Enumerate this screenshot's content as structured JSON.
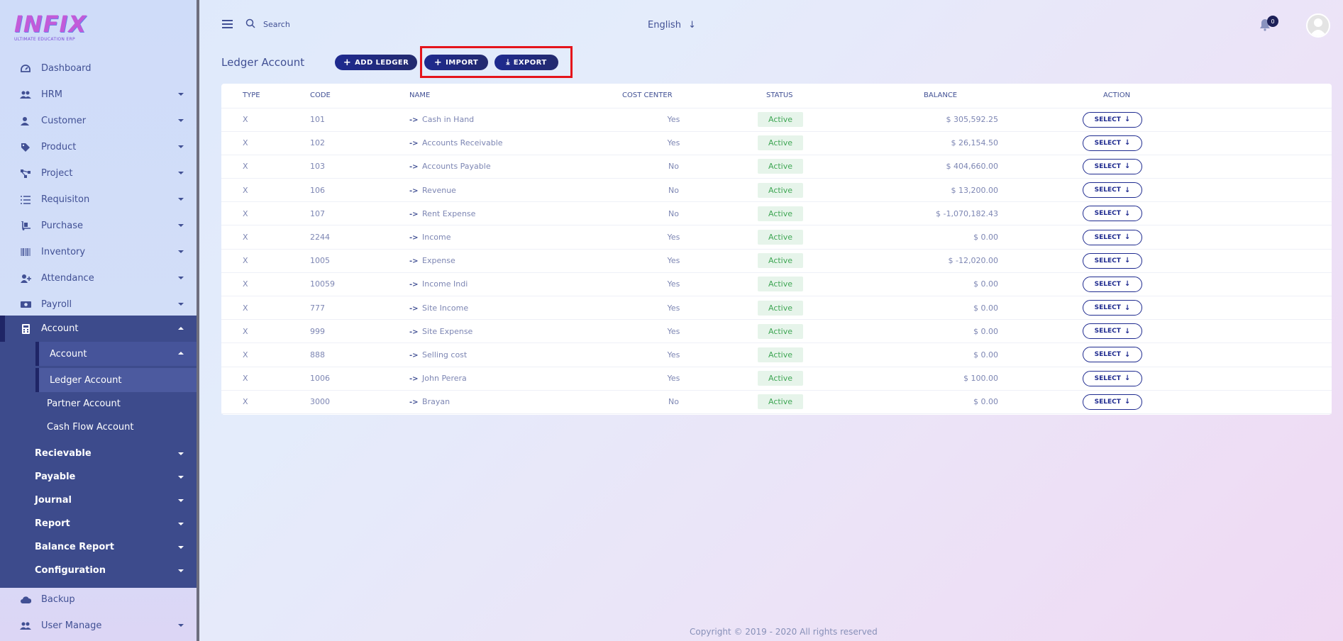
{
  "brand": {
    "logo_text": "INFIX",
    "tagline": "ULTIMATE EDUCATION ERP"
  },
  "sidebar": {
    "items": [
      {
        "label": "Dashboard",
        "icon": "dashboard-icon",
        "caret": false
      },
      {
        "label": "HRM",
        "icon": "users-icon",
        "caret": true
      },
      {
        "label": "Customer",
        "icon": "user-icon",
        "caret": true
      },
      {
        "label": "Product",
        "icon": "tags-icon",
        "caret": true
      },
      {
        "label": "Project",
        "icon": "project-icon",
        "caret": true
      },
      {
        "label": "Requisiton",
        "icon": "list-icon",
        "caret": true
      },
      {
        "label": "Purchase",
        "icon": "dolly-icon",
        "caret": true
      },
      {
        "label": "Inventory",
        "icon": "barcode-icon",
        "caret": true
      },
      {
        "label": "Attendance",
        "icon": "user-plus-icon",
        "caret": true
      },
      {
        "label": "Payroll",
        "icon": "money-icon",
        "caret": true
      }
    ],
    "account": {
      "label": "Account",
      "sub_label": "Account",
      "children": [
        "Ledger Account",
        "Partner Account",
        "Cash Flow Account"
      ],
      "groups": [
        "Recievable",
        "Payable",
        "Journal",
        "Report",
        "Balance Report",
        "Configuration"
      ]
    },
    "bottom_items": [
      {
        "label": "Backup",
        "icon": "cloud-icon",
        "caret": false
      },
      {
        "label": "User Manage",
        "icon": "users-icon",
        "caret": true
      }
    ]
  },
  "header": {
    "search_placeholder": "Search",
    "language": "English",
    "notification_count": "0"
  },
  "page": {
    "title": "Ledger Account",
    "buttons": {
      "add": "ADD LEDGER",
      "import": "IMPORT",
      "export": "EXPORT"
    }
  },
  "table": {
    "columns": [
      "TYPE",
      "CODE",
      "NAME",
      "COST CENTER",
      "STATUS",
      "BALANCE",
      "ACTION"
    ],
    "action_label": "SELECT",
    "rows": [
      {
        "type": "X",
        "code": "101",
        "name": "Cash in Hand",
        "cost_center": "Yes",
        "status": "Active",
        "balance": "$ 305,592.25"
      },
      {
        "type": "X",
        "code": "102",
        "name": "Accounts Receivable",
        "cost_center": "Yes",
        "status": "Active",
        "balance": "$ 26,154.50"
      },
      {
        "type": "X",
        "code": "103",
        "name": "Accounts Payable",
        "cost_center": "No",
        "status": "Active",
        "balance": "$ 404,660.00"
      },
      {
        "type": "X",
        "code": "106",
        "name": "Revenue",
        "cost_center": "No",
        "status": "Active",
        "balance": "$ 13,200.00"
      },
      {
        "type": "X",
        "code": "107",
        "name": "Rent Expense",
        "cost_center": "No",
        "status": "Active",
        "balance": "$ -1,070,182.43"
      },
      {
        "type": "X",
        "code": "2244",
        "name": "Income",
        "cost_center": "Yes",
        "status": "Active",
        "balance": "$ 0.00"
      },
      {
        "type": "X",
        "code": "1005",
        "name": "Expense",
        "cost_center": "Yes",
        "status": "Active",
        "balance": "$ -12,020.00"
      },
      {
        "type": "X",
        "code": "10059",
        "name": "Income Indi",
        "cost_center": "Yes",
        "status": "Active",
        "balance": "$ 0.00"
      },
      {
        "type": "X",
        "code": "777",
        "name": "Site Income",
        "cost_center": "Yes",
        "status": "Active",
        "balance": "$ 0.00"
      },
      {
        "type": "X",
        "code": "999",
        "name": "Site Expense",
        "cost_center": "Yes",
        "status": "Active",
        "balance": "$ 0.00"
      },
      {
        "type": "X",
        "code": "888",
        "name": "Selling cost",
        "cost_center": "Yes",
        "status": "Active",
        "balance": "$ 0.00"
      },
      {
        "type": "X",
        "code": "1006",
        "name": "John Perera",
        "cost_center": "Yes",
        "status": "Active",
        "balance": "$ 100.00"
      },
      {
        "type": "X",
        "code": "3000",
        "name": "Brayan",
        "cost_center": "No",
        "status": "Active",
        "balance": "$ 0.00"
      }
    ]
  },
  "footer": {
    "text": "Copyright © 2019 - 2020 All rights reserved"
  },
  "colors": {
    "primary": "#1e2a8f",
    "sidebar_active": "#3d4b8c",
    "highlight": "#e5141b",
    "status_green": "#3fa654"
  }
}
